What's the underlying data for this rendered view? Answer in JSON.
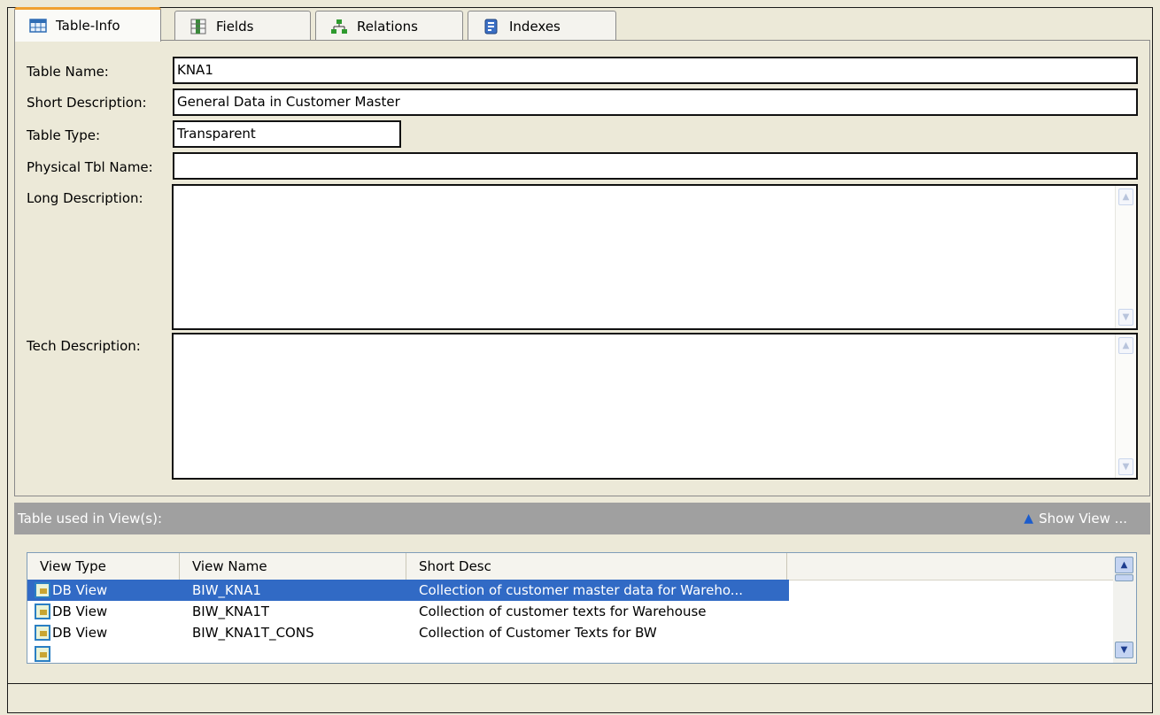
{
  "tabs": [
    {
      "label": "Table-Info",
      "icon": "table-icon",
      "active": true
    },
    {
      "label": "Fields",
      "icon": "fields-icon",
      "active": false
    },
    {
      "label": "Relations",
      "icon": "relations-icon",
      "active": false
    },
    {
      "label": "Indexes",
      "icon": "indexes-icon",
      "active": false
    }
  ],
  "form": {
    "table_name": {
      "label": "Table Name:",
      "value": "KNA1"
    },
    "short_description": {
      "label": "Short Description:",
      "value": "General Data in Customer Master"
    },
    "table_type": {
      "label": "Table Type:",
      "value": "Transparent"
    },
    "physical_tbl_name": {
      "label": "Physical Tbl Name:",
      "value": ""
    },
    "long_description": {
      "label": "Long Description:",
      "value": ""
    },
    "tech_description": {
      "label": "Tech Description:",
      "value": ""
    }
  },
  "views": {
    "header": "Table used in View(s):",
    "show_view": "Show View ...",
    "columns": [
      "View Type",
      "View Name",
      "Short Desc"
    ],
    "rows": [
      {
        "type": "DB View",
        "name": "BIW_KNA1",
        "desc": "Collection of customer master data for Wareho...",
        "selected": true
      },
      {
        "type": "DB View",
        "name": "BIW_KNA1T",
        "desc": "Collection of customer texts for Warehouse",
        "selected": false
      },
      {
        "type": "DB View",
        "name": "BIW_KNA1T_CONS",
        "desc": "Collection of Customer Texts for BW",
        "selected": false
      }
    ]
  },
  "colors": {
    "selection": "#316ac5",
    "tab_accent": "#f0a030",
    "section_header": "#a0a0a0"
  }
}
